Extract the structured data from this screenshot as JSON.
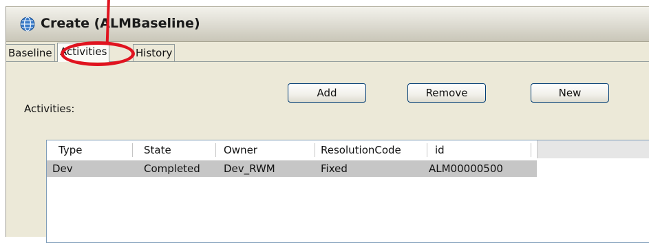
{
  "window": {
    "title": "Create (ALMBaseline)"
  },
  "tabs": [
    {
      "label": "Baseline"
    },
    {
      "label": "Activities"
    },
    {
      "label": "History"
    }
  ],
  "activities": {
    "label": "Activities:",
    "buttons": {
      "add": "Add",
      "remove": "Remove",
      "new": "New"
    },
    "table": {
      "columns": [
        "Type",
        "State",
        "Owner",
        "ResolutionCode",
        "id"
      ],
      "rows": [
        [
          "Dev",
          "Completed",
          "Dev_RWM",
          "Fixed",
          "ALM00000500"
        ]
      ]
    }
  },
  "colors": {
    "annotation": "#e0131f",
    "selected_row": "#c6c6c6",
    "button_border": "#003c74",
    "window_bg": "#ece9d8"
  },
  "icons": {
    "window": "globe-icon"
  }
}
